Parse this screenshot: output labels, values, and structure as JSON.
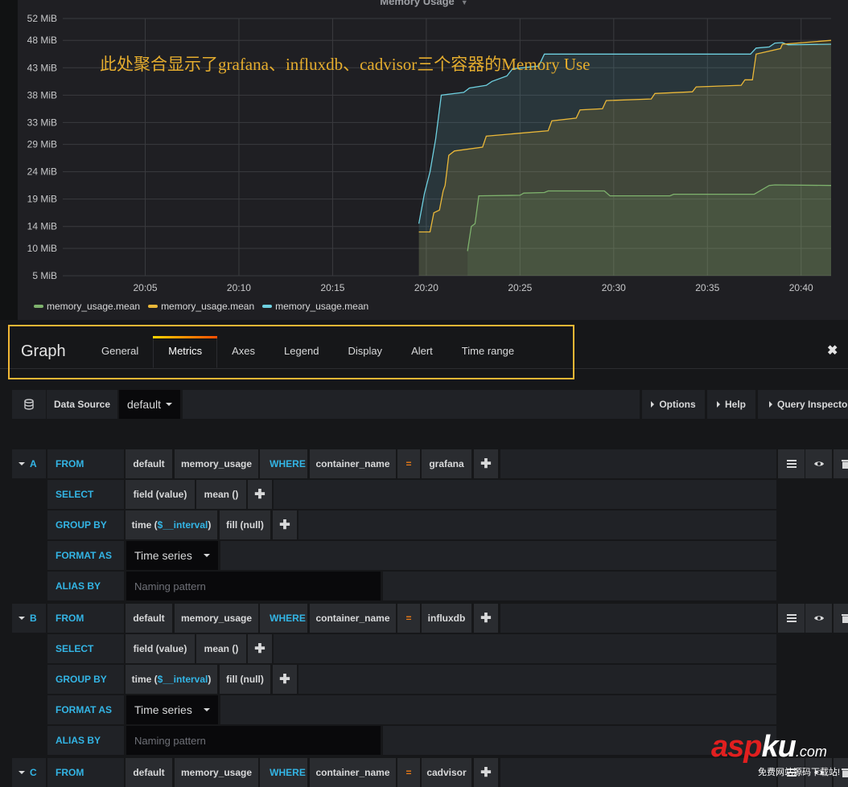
{
  "panel": {
    "title": "Memory Usage",
    "annotation": "此处聚合显示了grafana、influxdb、cadvisor三个容器的Memory Use"
  },
  "chart_data": {
    "type": "area",
    "title": "Memory Usage",
    "xlabel": "",
    "ylabel": "",
    "y_unit": "MiB",
    "y_ticks": [
      "52 MiB",
      "48 MiB",
      "43 MiB",
      "38 MiB",
      "33 MiB",
      "29 MiB",
      "24 MiB",
      "19 MiB",
      "14 MiB",
      "10 MiB",
      "5 MiB"
    ],
    "y_tick_values": [
      52,
      48,
      43,
      38,
      33,
      29,
      24,
      19,
      14,
      10,
      5
    ],
    "ylim": [
      5,
      52
    ],
    "x_ticks": [
      "20:05",
      "20:10",
      "20:15",
      "20:20",
      "20:25",
      "20:30",
      "20:35",
      "20:40"
    ],
    "x_tick_minutes": [
      5,
      10,
      15,
      20,
      25,
      30,
      35,
      40
    ],
    "xlim_minutes": [
      0.6,
      41.6
    ],
    "x_note": "x values are minutes after 20:00",
    "grid": true,
    "legend_position": "bottom-left",
    "series": [
      {
        "name": "memory_usage.mean",
        "color": "#7eb26d",
        "x": [
          22.2,
          22.4,
          22.6,
          22.8,
          25.0,
          25.2,
          26.3,
          26.5,
          29.5,
          29.8,
          33.0,
          33.2,
          37.5,
          38.3,
          38.6,
          41.6
        ],
        "y": [
          9.5,
          14.0,
          14.5,
          19.6,
          19.7,
          20.1,
          20.2,
          20.5,
          20.5,
          19.6,
          19.6,
          19.9,
          19.9,
          21.5,
          21.6,
          21.5
        ]
      },
      {
        "name": "memory_usage.mean",
        "color": "#eab839",
        "x": [
          19.6,
          20.2,
          20.4,
          20.7,
          20.9,
          21.0,
          21.2,
          21.5,
          23.0,
          23.2,
          26.5,
          26.7,
          28.0,
          28.2,
          29.4,
          29.6,
          32.0,
          32.2,
          34.2,
          34.4,
          36.8,
          37.0,
          37.4,
          37.6,
          38.9,
          39.0,
          41.6
        ],
        "y": [
          13.0,
          13.0,
          16.5,
          17.0,
          20.5,
          21.5,
          27.0,
          27.8,
          28.5,
          30.5,
          31.5,
          33.3,
          33.8,
          35.3,
          35.5,
          37.0,
          37.3,
          38.3,
          38.6,
          39.5,
          39.8,
          40.8,
          40.8,
          45.5,
          46.5,
          47.3,
          48.0
        ]
      },
      {
        "name": "memory_usage.mean",
        "color": "#6ed0e0",
        "x": [
          19.6,
          19.9,
          20.2,
          20.5,
          20.8,
          22.0,
          22.3,
          23.2,
          23.5,
          24.3,
          24.6,
          26.0,
          26.3,
          30.0,
          33.0,
          37.3,
          37.6,
          38.3,
          38.6,
          39.0,
          39.3,
          41.6
        ],
        "y": [
          14.5,
          20.0,
          24.0,
          30.0,
          38.0,
          38.5,
          39.3,
          39.8,
          40.5,
          41.5,
          42.8,
          43.3,
          45.5,
          45.5,
          45.5,
          45.5,
          46.6,
          46.8,
          47.5,
          47.6,
          47.2,
          47.3
        ]
      }
    ]
  },
  "legend": [
    {
      "label": "memory_usage.mean",
      "color": "#7eb26d"
    },
    {
      "label": "memory_usage.mean",
      "color": "#eab839"
    },
    {
      "label": "memory_usage.mean",
      "color": "#6ed0e0"
    }
  ],
  "editor": {
    "title": "Graph",
    "tabs": [
      "General",
      "Metrics",
      "Axes",
      "Legend",
      "Display",
      "Alert",
      "Time range"
    ],
    "active_tab": "Metrics",
    "close_icon": "close-icon",
    "accent_color": "#f1b735"
  },
  "datasource": {
    "icon": "database-icon",
    "label": "Data Source",
    "value": "default",
    "buttons": [
      "Options",
      "Help",
      "Query Inspector"
    ]
  },
  "queries": [
    {
      "ref_id": "A",
      "from_kw": "FROM",
      "policy": "default",
      "measurement": "memory_usage",
      "where_kw": "WHERE",
      "tag_key": "container_name",
      "operator": "=",
      "tag_value": "grafana",
      "select_kw": "SELECT",
      "field": "field (value)",
      "agg": "mean ()",
      "groupby_kw": "GROUP BY",
      "time_pre": "time (",
      "time_var": "$__interval",
      "time_post": ")",
      "fill": "fill (null)",
      "format_kw": "FORMAT AS",
      "format": "Time series",
      "alias_kw": "ALIAS BY",
      "alias_placeholder": "Naming pattern"
    },
    {
      "ref_id": "B",
      "from_kw": "FROM",
      "policy": "default",
      "measurement": "memory_usage",
      "where_kw": "WHERE",
      "tag_key": "container_name",
      "operator": "=",
      "tag_value": "influxdb",
      "select_kw": "SELECT",
      "field": "field (value)",
      "agg": "mean ()",
      "groupby_kw": "GROUP BY",
      "time_pre": "time (",
      "time_var": "$__interval",
      "time_post": ")",
      "fill": "fill (null)",
      "format_kw": "FORMAT AS",
      "format": "Time series",
      "alias_kw": "ALIAS BY",
      "alias_placeholder": "Naming pattern"
    },
    {
      "ref_id": "C",
      "from_kw": "FROM",
      "policy": "default",
      "measurement": "memory_usage",
      "where_kw": "WHERE",
      "tag_key": "container_name",
      "operator": "=",
      "tag_value": "cadvisor"
    }
  ],
  "watermark": {
    "brand_a": "asp",
    "brand_b": "ku",
    "domain": ".com",
    "tagline": "免费网站源码下载站!"
  }
}
